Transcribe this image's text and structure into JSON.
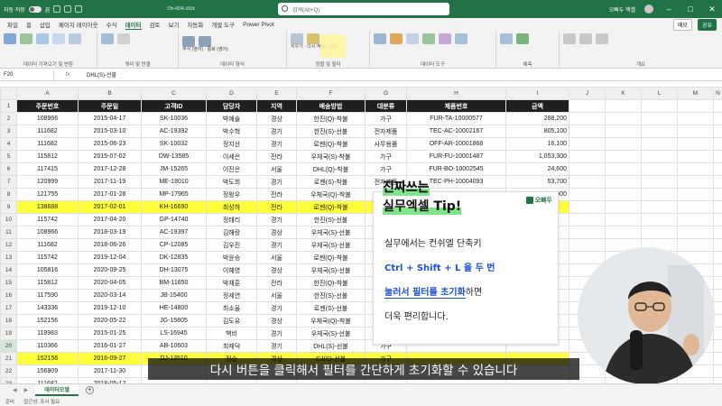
{
  "titlebar": {
    "autosave_label": "자동 저장",
    "autosave_state": "끔",
    "filename": "05-004.xlsx",
    "search_placeholder": "검색(Alt+Q)",
    "user_name": "오빠두 엑셀"
  },
  "ribbon_tabs": [
    "파일",
    "홈",
    "삽입",
    "페이지 레이아웃",
    "수식",
    "데이터",
    "검토",
    "보기",
    "자동화",
    "개발 도구",
    "Power Pivot"
  ],
  "active_tab": "데이터",
  "ribbon_buttons": {
    "comments": "메모",
    "share": "공유"
  },
  "ribbon_groups": [
    "데이터 가져오기 및 변환",
    "쿼리 및 연결",
    "데이터 형식",
    "정렬 및 필터",
    "데이터 도구",
    "예측",
    "개요"
  ],
  "ribbon_small": {
    "data_types_1": "주식 (영어)",
    "data_types_2": "통화 (영어)",
    "clear": "지우기",
    "reapply": "다시 적용",
    "advanced": "고급"
  },
  "formula_bar": {
    "cell": "F20",
    "fx": "fx",
    "formula": "DHL(S)-선불"
  },
  "columns": [
    "A",
    "B",
    "C",
    "D",
    "E",
    "F",
    "G",
    "H",
    "I",
    "J",
    "K",
    "L",
    "M",
    "N"
  ],
  "headers": [
    "주문번호",
    "주문일",
    "고객ID",
    "담당자",
    "지역",
    "배송방법",
    "대분류",
    "제품번호",
    "금액"
  ],
  "rows": [
    {
      "n": "2",
      "cells": [
        "108966",
        "2015-04-17",
        "SK-10036",
        "박예솔",
        "경상",
        "한진(Q)-착불",
        "가구",
        "FUR-TA-10000577",
        "288,200"
      ]
    },
    {
      "n": "3",
      "cells": [
        "111682",
        "2015-03-10",
        "AC-19392",
        "박수혁",
        "경기",
        "한진(S)-선불",
        "전자제품",
        "TEC-AC-10002167",
        "805,100"
      ]
    },
    {
      "n": "4",
      "cells": [
        "111682",
        "2015-06-23",
        "SK-10032",
        "정지산",
        "경기",
        "로젠(Q)-착불",
        "사무용품",
        "OFF-AR-10001868",
        "16,100"
      ]
    },
    {
      "n": "5",
      "cells": [
        "115812",
        "2015-07-02",
        "DW-13585",
        "이세은",
        "전라",
        "우체국(S)-착불",
        "가구",
        "FUR-FU-10001487",
        "1,053,300"
      ]
    },
    {
      "n": "6",
      "cells": [
        "117415",
        "2017-12-28",
        "JM-15265",
        "이진은",
        "서울",
        "DHL(Q)-착불",
        "가구",
        "FUR-BO-10002545",
        "24,600"
      ]
    },
    {
      "n": "7",
      "cells": [
        "120999",
        "2017-11-19",
        "ME-18010",
        "박도희",
        "경기",
        "로젠(S)-착불",
        "전자제품",
        "TEC-PH-10004093",
        "53,700"
      ]
    },
    {
      "n": "8",
      "cells": [
        "121755",
        "2017-01-28",
        "MP-17965",
        "정왕우",
        "전라",
        "우체국(Q)-착불",
        "사무용품",
        "OFF-BI-10001634",
        "8,000"
      ]
    },
    {
      "n": "9",
      "cells": [
        "138688",
        "2017-02-01",
        "KH-16690",
        "최성하",
        "전라",
        "로젠(Q)-착불",
        "가구",
        "",
        ""
      ]
    },
    {
      "n": "10",
      "cells": [
        "115742",
        "2017-04-20",
        "GP-14740",
        "정태리",
        "경기",
        "한진(S)-선불",
        "가구",
        "",
        ""
      ]
    },
    {
      "n": "11",
      "cells": [
        "108966",
        "2018-03-19",
        "AC-19397",
        "김해랑",
        "경상",
        "우체국(S)-선불",
        "가구",
        "",
        ""
      ]
    },
    {
      "n": "12",
      "cells": [
        "111682",
        "2018-06-26",
        "CP-12085",
        "김우진",
        "경기",
        "우체국(S)-선불",
        "가구",
        "",
        ""
      ]
    },
    {
      "n": "13",
      "cells": [
        "115742",
        "2019-12-04",
        "DK-12835",
        "박윤승",
        "서울",
        "로젠(Q)-착불",
        "가구",
        "",
        ""
      ]
    },
    {
      "n": "14",
      "cells": [
        "105816",
        "2020-09-25",
        "DH-13075",
        "이혜영",
        "경상",
        "우체국(S)-선불",
        "가구",
        "",
        ""
      ]
    },
    {
      "n": "15",
      "cells": [
        "115812",
        "2020-04-05",
        "BM-11650",
        "박채훈",
        "전라",
        "한진(Q)-착불",
        "가구",
        "",
        ""
      ]
    },
    {
      "n": "16",
      "cells": [
        "117590",
        "2020-03-14",
        "JB-15400",
        "정세연",
        "서울",
        "한진(S)-선불",
        "가구",
        "",
        ""
      ]
    },
    {
      "n": "17",
      "cells": [
        "143336",
        "2019-12-10",
        "HE-14800",
        "최소율",
        "경기",
        "로젠(S)-선불",
        "가구",
        "",
        ""
      ]
    },
    {
      "n": "18",
      "cells": [
        "152156",
        "2020-05-22",
        "JG-15805",
        "김도유",
        "경상",
        "우체국(Q)-착불",
        "가구",
        "",
        ""
      ]
    },
    {
      "n": "19",
      "cells": [
        "118983",
        "2015-01-25",
        "LS-16945",
        "백비",
        "경기",
        "우체국(S)-선불",
        "가구",
        "",
        ""
      ]
    },
    {
      "n": "20",
      "cells": [
        "110366",
        "2016-01-27",
        "AB-10603",
        "최제덕",
        "경기",
        "DHL(S)-선불",
        "가구",
        "",
        ""
      ]
    },
    {
      "n": "21",
      "cells": [
        "152156",
        "2016-09-27",
        "DJ-13510",
        "정승",
        "경상",
        "CJ(S)-선불",
        "가구",
        "",
        ""
      ]
    },
    {
      "n": "22",
      "cells": [
        "156909",
        "2017-11-30",
        "",
        "",
        "",
        "",
        "",
        "",
        ""
      ]
    },
    {
      "n": "23",
      "cells": [
        "111682",
        "2018-05-12",
        "",
        "",
        "",
        "",
        "",
        "",
        ""
      ]
    }
  ],
  "highlight_rows": [
    "9",
    "21"
  ],
  "selected_row": "20",
  "sheet": {
    "tab_label": "데이터모델",
    "add_label": "+"
  },
  "status": {
    "ready": "준비",
    "accessibility": "접근성: 조사 필요"
  },
  "tip": {
    "title_line1": "진짜쓰는",
    "title_line2": "실무엑셀 Tip!",
    "logo": "오빠두",
    "line1": "실무에서는 컨쉬엘 단축키",
    "line2": "Ctrl + Shift + L 을 두 번",
    "line3_bold": "눌러서 필터를 초기화",
    "line3_rest": "하면",
    "line4": "더욱 편리합니다."
  },
  "subtitle": "다시 버튼을 클릭해서 필터를 간단하게 초기화할 수 있습니다",
  "colors": {
    "excel_green": "#217346",
    "highlight": "#ffff3a",
    "tip_accent": "#7ee58a",
    "shortcut_blue": "#1a4fd6"
  }
}
